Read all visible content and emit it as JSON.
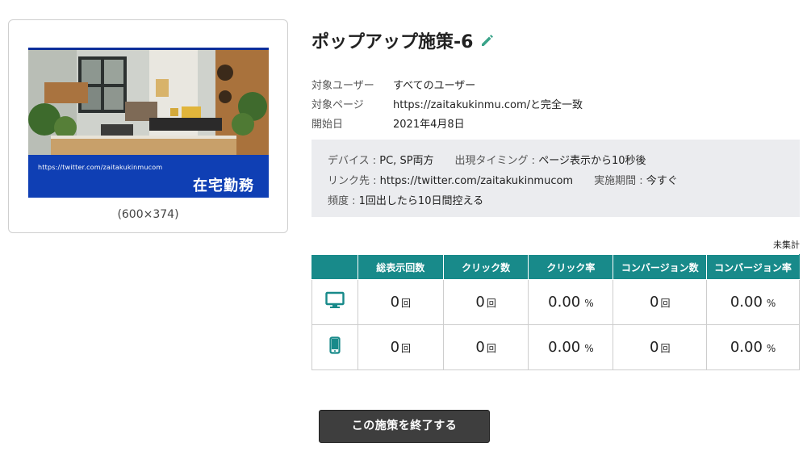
{
  "preview": {
    "banner_url": "https://twitter.com/zaitakukinmucom",
    "banner_title": "在宅勤務",
    "size_label": "(600×374)"
  },
  "campaign": {
    "title": "ポップアップ施策-6",
    "edit_icon": "pencil-icon"
  },
  "meta": [
    {
      "label": "対象ユーザー",
      "value": "すべてのユーザー"
    },
    {
      "label": "対象ページ",
      "value": "https://zaitakukinmu.com/と完全一致"
    },
    {
      "label": "開始日",
      "value": "2021年4月8日"
    }
  ],
  "settings": {
    "device_label": "デバイス : ",
    "device_value": "PC, SP両方",
    "timing_label": "出現タイミング : ",
    "timing_value": "ページ表示から10秒後",
    "link_label": "リンク先 : ",
    "link_value": "https://twitter.com/zaitakukinmucom",
    "period_label": "実施期間 : ",
    "period_value": "今すぐ",
    "frequency_label": "頻度 : ",
    "frequency_value": "1回出したら10日間控える"
  },
  "stats": {
    "status": "未集計",
    "headers": [
      "",
      "総表示回数",
      "クリック数",
      "クリック率",
      "コンバージョン数",
      "コンバージョン率"
    ],
    "rows": [
      {
        "device": "desktop-icon",
        "impressions": "0",
        "clicks": "0",
        "ctr": "0.00",
        "conversions": "0",
        "cvr": "0.00"
      },
      {
        "device": "smartphone-icon",
        "impressions": "0",
        "clicks": "0",
        "ctr": "0.00",
        "conversions": "0",
        "cvr": "0.00"
      }
    ],
    "count_unit": "回",
    "percent_unit": "%"
  },
  "actions": {
    "end_label": "この施策を終了する"
  },
  "colors": {
    "accent": "#188a8a",
    "banner_blue": "#0f3fb4",
    "button_dark": "#3e3e3e"
  }
}
